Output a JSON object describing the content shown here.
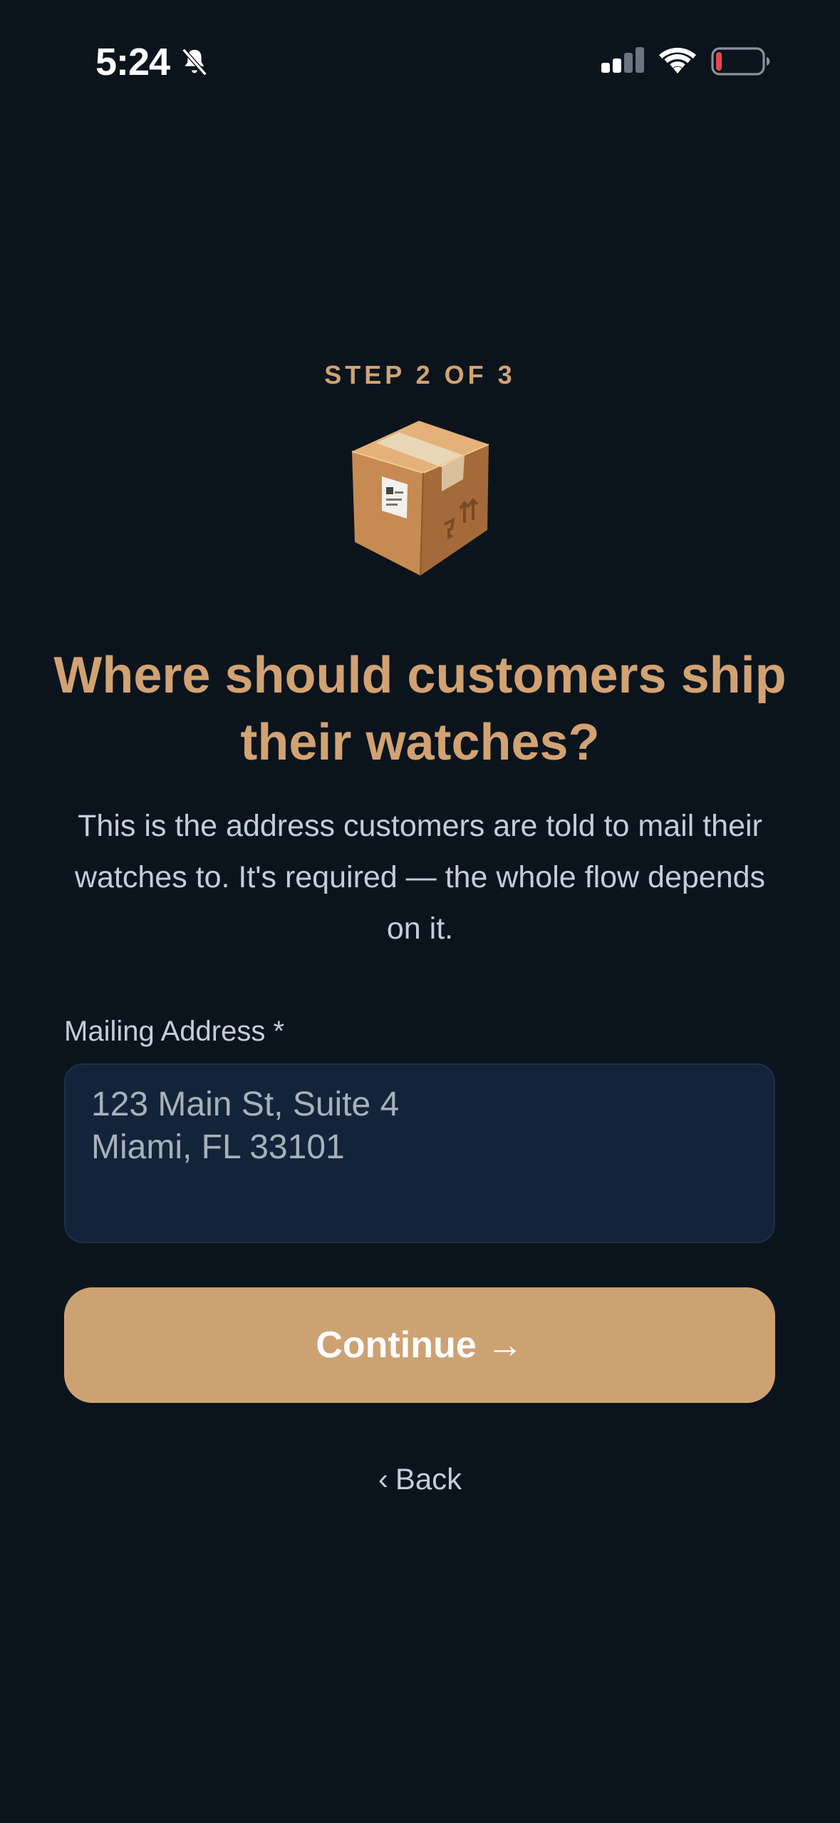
{
  "status_bar": {
    "time": "5:24",
    "battery_color": "#e5484d"
  },
  "onboarding": {
    "step_label": "STEP 2 OF 3",
    "icon": "package-box-icon",
    "headline": "Where should customers ship their watches?",
    "description": "This is the address customers are told to mail their watches to. It's required — the whole flow depends on it.",
    "address_label": "Mailing Address *",
    "address_placeholder": "123 Main St, Suite 4\nMiami, FL 33101",
    "address_value": "",
    "continue_label": "Continue",
    "continue_arrow": "→",
    "back_chevron": "‹",
    "back_label": "Back"
  },
  "colors": {
    "background": "#0b141d",
    "accent": "#cda273",
    "input_background": "#13243a"
  }
}
